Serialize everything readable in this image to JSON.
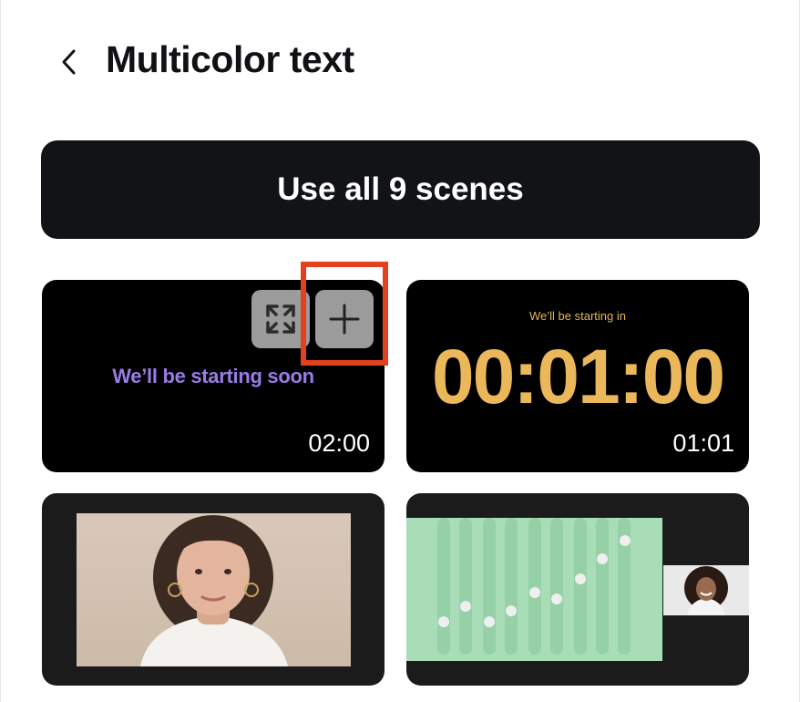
{
  "header": {
    "back_icon": "chevron-left-icon",
    "title": "Multicolor text"
  },
  "use_all_button": {
    "label": "Use all 9 scenes"
  },
  "scenes": [
    {
      "id": "scene-1",
      "overlay_text": "We’ll be starting soon",
      "duration": "02:00",
      "text_color": "#9b7be6",
      "actions": {
        "expand_icon": "expand-arrows-icon",
        "add_icon": "plus-icon"
      }
    },
    {
      "id": "scene-2",
      "caption": "We’ll be starting in",
      "countdown": "00:01:00",
      "duration": "01:01",
      "text_color": "#eab75b"
    },
    {
      "id": "scene-3",
      "image": "portrait-woman-photo"
    },
    {
      "id": "scene-4",
      "image": "green-sliders-photo",
      "pip_image": "smiling-woman-photo"
    }
  ],
  "colors": {
    "dark_button": "#111317",
    "highlight": "#e2401e"
  }
}
